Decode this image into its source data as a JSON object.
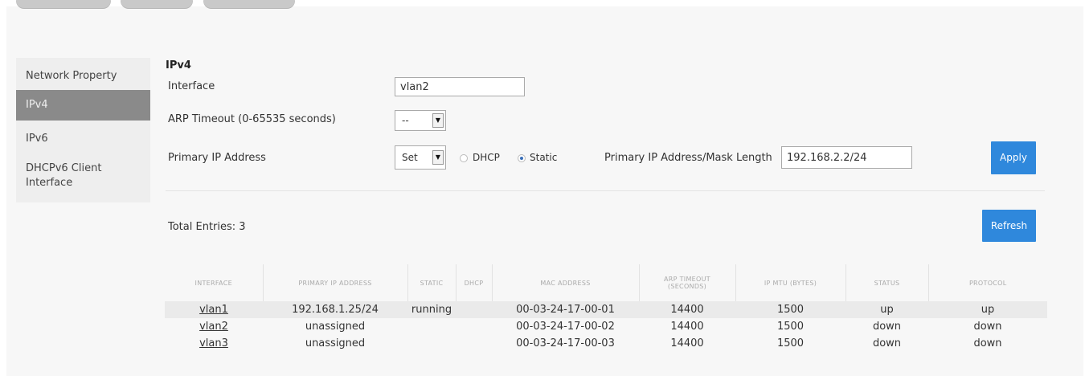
{
  "sidebar": {
    "items": [
      {
        "label": "Network Property"
      },
      {
        "label": "IPv4"
      },
      {
        "label": "IPv6"
      },
      {
        "label": "DHCPv6 Client"
      },
      {
        "label": "Interface"
      }
    ]
  },
  "ipv4": {
    "section_title": "IPv4",
    "interface_label": "Interface",
    "interface_value": "vlan2",
    "arp_timeout_label": "ARP Timeout (0-65535 seconds)",
    "arp_timeout_value": "--",
    "primary_ip_label": "Primary IP Address",
    "primary_ip_select": "Set",
    "dhcp_label": "DHCP",
    "static_label": "Static",
    "selected_mode": "Static",
    "mask_label": "Primary IP Address/Mask Length",
    "mask_value": "192.168.2.2/24",
    "apply_label": "Apply"
  },
  "table": {
    "total_entries": "Total Entries: 3",
    "refresh_label": "Refresh",
    "headers": [
      "INTERFACE",
      "PRIMARY IP ADDRESS",
      "STATIC",
      "DHCP",
      "MAC ADDRESS",
      "ARP TIMEOUT",
      "(SECONDS)",
      "IP MTU (BYTES)",
      "STATUS",
      "PROTOCOL"
    ],
    "rows": [
      {
        "interface": "vlan1",
        "ip": "192.168.1.25/24",
        "static": "running",
        "dhcp": "",
        "mac": "00-03-24-17-00-01",
        "arp": "14400",
        "mtu": "1500",
        "status": "up",
        "protocol": "up"
      },
      {
        "interface": "vlan2",
        "ip": "unassigned",
        "static": "",
        "dhcp": "",
        "mac": "00-03-24-17-00-02",
        "arp": "14400",
        "mtu": "1500",
        "status": "down",
        "protocol": "down"
      },
      {
        "interface": "vlan3",
        "ip": "unassigned",
        "static": "",
        "dhcp": "",
        "mac": "00-03-24-17-00-03",
        "arp": "14400",
        "mtu": "1500",
        "status": "down",
        "protocol": "down"
      }
    ]
  },
  "colors": {
    "accent": "#2f88dc",
    "sidebar_active": "#8a8a8a",
    "row_highlight": "#eaeaea"
  }
}
